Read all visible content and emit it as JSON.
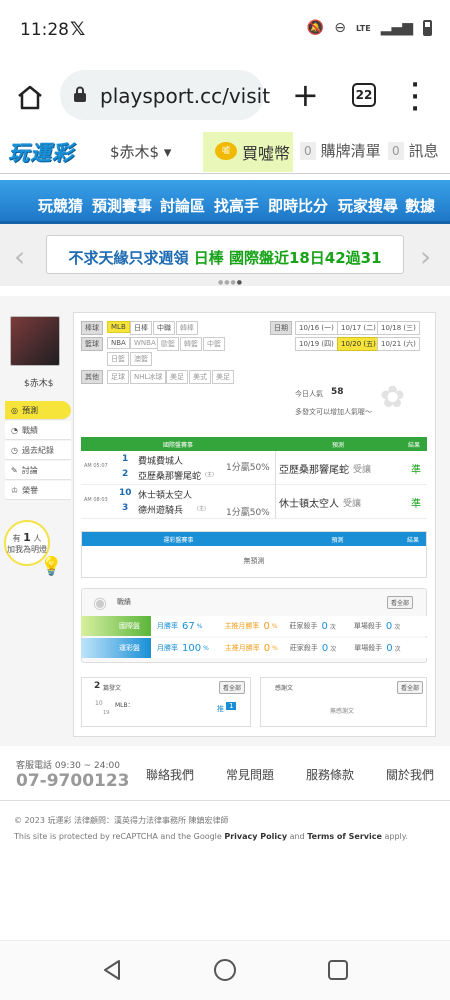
{
  "status": {
    "time": "11:28",
    "network": "LTE"
  },
  "browser": {
    "url": "playsport.cc/visit",
    "tab_count": "22"
  },
  "header": {
    "logo": "玩運彩",
    "user": "$赤木$ ▾",
    "coin_label": "買噓幣",
    "cart_count": "0",
    "cart_label": "購牌清單",
    "msg_count": "0",
    "msg_label": "訊息"
  },
  "nav": [
    "玩競猜",
    "預測賽事",
    "討論區",
    "找高手",
    "即時比分",
    "玩家搜尋",
    "數據"
  ],
  "banner": {
    "text1": "不求天緣只求週領",
    "text2": "日棒",
    "text3": "國際盤近18日42過31"
  },
  "profile": {
    "name": "$赤木$"
  },
  "sidebar": [
    {
      "label": "預測",
      "active": true,
      "icon": "target-icon"
    },
    {
      "label": "戰績",
      "icon": "chart-icon"
    },
    {
      "label": "過去紀錄",
      "icon": "history-icon"
    },
    {
      "label": "討論",
      "icon": "chat-icon"
    },
    {
      "label": "榮譽",
      "icon": "medal-icon"
    }
  ],
  "bulb": {
    "line1": "有",
    "count": "1",
    "line1b": "人",
    "line2": "加我為明燈"
  },
  "filters": {
    "baseball_label": "棒球",
    "baseball": [
      "MLB",
      "日棒",
      "中職",
      "韓棒"
    ],
    "basketball_label": "籃球",
    "basketball": [
      "NBA",
      "WNBA",
      "歐籃",
      "韓籃",
      "中籃",
      "日籃",
      "澳籃"
    ],
    "other_label": "其他",
    "other": [
      "足球",
      "NHL冰球",
      "美足",
      "美式",
      "美足"
    ]
  },
  "dates": {
    "label": "日期",
    "items": [
      "10/16 (一)",
      "10/17 (二)",
      "10/18 (三)",
      "10/19 (四)",
      "10/20 (五)",
      "10/21 (六)"
    ],
    "selected": "10/20 (五)"
  },
  "visitors": {
    "label": "今日人氣",
    "count": "58",
    "note": "多發文可以增加人氣喔～"
  },
  "intl_table": {
    "headers": [
      "國際盤賽事",
      "預測",
      "結果"
    ],
    "rows": [
      {
        "time": "AM 05:07",
        "home_no": "1",
        "home": "費城費城人",
        "away_no": "2",
        "away": "亞歷桑那響尾蛇",
        "away_tag": "(主)",
        "odds": "1分贏50%",
        "pick": "亞歷桑那響尾蛇",
        "pick_tag": "受讓",
        "result": "準"
      },
      {
        "time": "AM 08:03",
        "home_no": "10",
        "home": "休士頓太空人",
        "away_no": "3",
        "away": "德州遊騎兵",
        "away_tag": "(主)",
        "odds": "1分贏50%",
        "pick": "休士頓太空人",
        "pick_tag": "受讓",
        "result": "準"
      }
    ]
  },
  "sport_table": {
    "headers": [
      "運彩盤賽事",
      "預測",
      "結果"
    ],
    "empty": "無預測"
  },
  "record": {
    "title": "戰績",
    "more": "看全部",
    "rows": [
      {
        "label": "國際盤",
        "win_label": "月勝率",
        "win": "67",
        "main_label": "主推月勝率",
        "main": "0",
        "kill_label": "莊家殺手",
        "kill": "0",
        "single_label": "單場殺手",
        "single": "0"
      },
      {
        "label": "運彩盤",
        "win_label": "月勝率",
        "win": "100",
        "main_label": "主推月勝率",
        "main": "0",
        "kill_label": "莊家殺手",
        "kill": "0",
        "single_label": "單場殺手",
        "single": "0"
      }
    ],
    "unit": "次",
    "pct": "%"
  },
  "posts": {
    "count": "2",
    "label": "篇發文",
    "more": "看全部",
    "date_m": "10",
    "date_d": "19",
    "category": "MLB：",
    "reply_label": "推",
    "reply": "1"
  },
  "reviews": {
    "label": "感謝文",
    "more": "看全部",
    "empty": "無感謝文"
  },
  "footer": {
    "service": "客服電話 09:30 ~ 24:00",
    "phone": "07-9700123",
    "links": [
      "聯絡我們",
      "常見問題",
      "服務條款",
      "關於我們"
    ],
    "copyright": "© 2023 玩運彩 法律顧問：漢英得力法律事務所 陳鎮宏律師",
    "recaptcha1": "This site is protected by reCAPTCHA and the Google",
    "privacy": "Privacy Policy",
    "and": "and",
    "terms": "Terms of Service",
    "apply": "apply."
  }
}
